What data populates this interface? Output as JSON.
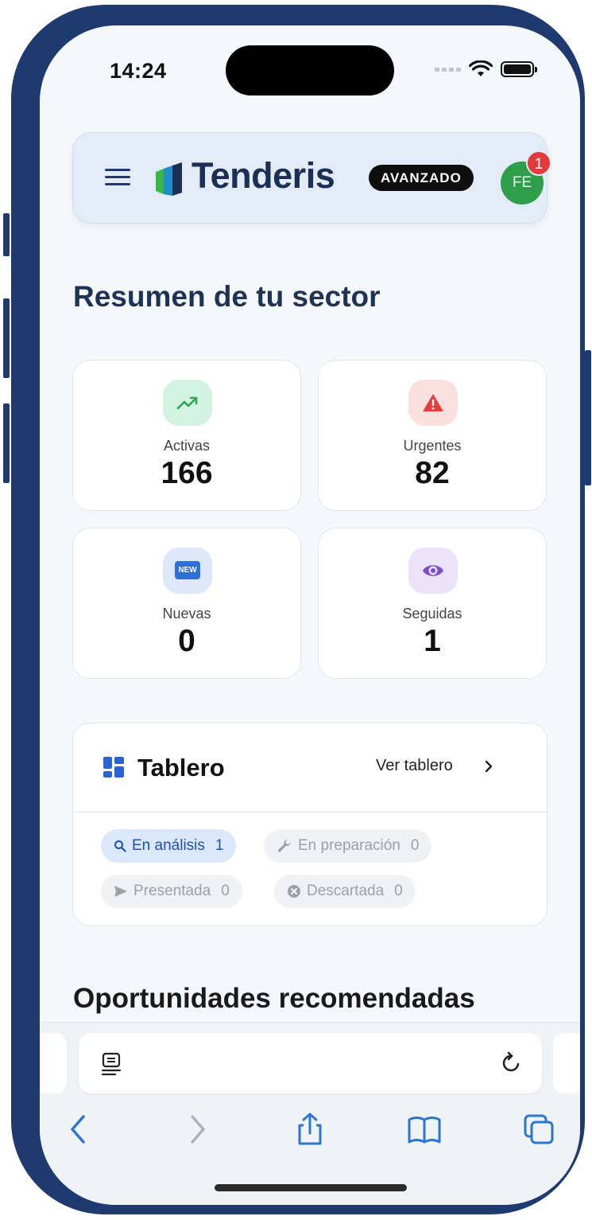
{
  "status_bar": {
    "time": "14:24"
  },
  "header": {
    "brand_name": "Tenderis",
    "plan_badge": "AVANZADO",
    "avatar_initials": "FE",
    "notification_count": "1"
  },
  "summary": {
    "title": "Resumen de tu sector",
    "cards": [
      {
        "label": "Activas",
        "value": "166",
        "icon": "trending-up-icon"
      },
      {
        "label": "Urgentes",
        "value": "82",
        "icon": "warning-icon"
      },
      {
        "label": "Nuevas",
        "value": "0",
        "icon": "new-icon"
      },
      {
        "label": "Seguidas",
        "value": "1",
        "icon": "eye-icon"
      }
    ]
  },
  "board": {
    "title": "Tablero",
    "link_label": "Ver tablero",
    "new_icon_text": "NEW",
    "chips": [
      {
        "label": "En análisis",
        "count": "1",
        "icon": "search-icon"
      },
      {
        "label": "En preparación",
        "count": "0",
        "icon": "wrench-icon"
      },
      {
        "label": "Presentada",
        "count": "0",
        "icon": "send-icon"
      },
      {
        "label": "Descartada",
        "count": "0",
        "icon": "close-circle-icon"
      }
    ]
  },
  "recommended": {
    "title": "Oportunidades recomendadas"
  },
  "colors": {
    "navy": "#1e3356",
    "accent_blue": "#2a63d6",
    "green": "#2f9e4a",
    "red": "#e23b3b",
    "purple": "#7b4fd0"
  }
}
